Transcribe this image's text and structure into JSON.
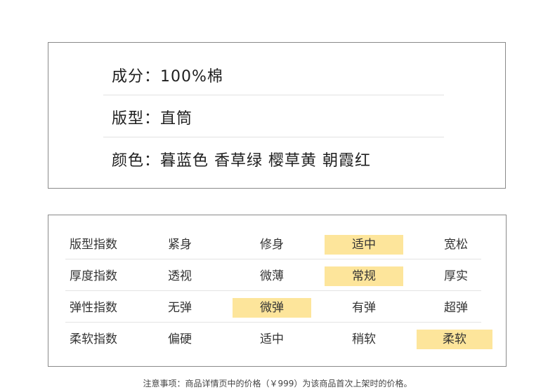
{
  "spec": {
    "composition": "成分：100%棉",
    "fit": "版型：直筒",
    "colors": "颜色：暮蓝色 香草绿 樱草黄 朝霞红"
  },
  "indices": [
    {
      "label": "版型指数",
      "options": [
        "紧身",
        "修身",
        "适中",
        "宽松"
      ],
      "selected": 2
    },
    {
      "label": "厚度指数",
      "options": [
        "透视",
        "微薄",
        "常规",
        "厚实"
      ],
      "selected": 2
    },
    {
      "label": "弹性指数",
      "options": [
        "无弹",
        "微弹",
        "有弹",
        "超弹"
      ],
      "selected": 1
    },
    {
      "label": "柔软指数",
      "options": [
        "偏硬",
        "适中",
        "稍软",
        "柔软"
      ],
      "selected": 3
    }
  ],
  "highlight_color": "#fde59b",
  "note": "注意事项：商品详情页中的价格（￥999）为该商品首次上架时的价格。"
}
